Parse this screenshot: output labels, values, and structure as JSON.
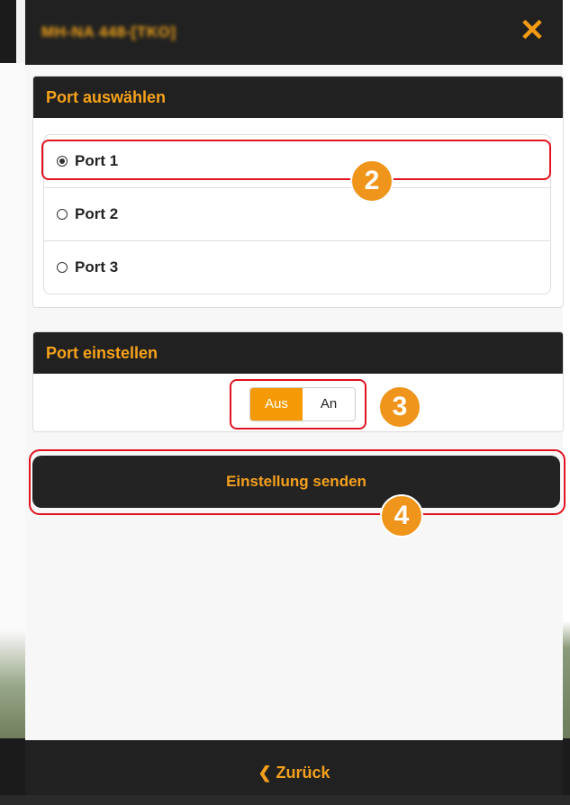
{
  "header": {
    "title": "MH-NA 448-[TKO]",
    "close_icon": "close-icon"
  },
  "port_select": {
    "heading": "Port auswählen",
    "options": [
      {
        "label": "Port 1",
        "checked": true
      },
      {
        "label": "Port 2",
        "checked": false
      },
      {
        "label": "Port 3",
        "checked": false
      }
    ]
  },
  "port_setting": {
    "heading": "Port einstellen",
    "off_label": "Aus",
    "on_label": "An",
    "active": "Aus"
  },
  "send_button": {
    "label": "Einstellung senden"
  },
  "footer": {
    "back_label": "❮ Zurück"
  },
  "annotations": {
    "badge_2": "2",
    "badge_3": "3",
    "badge_4": "4"
  },
  "colors": {
    "accent": "#f59a06",
    "highlight": "#e2121f",
    "dark": "#212121"
  }
}
